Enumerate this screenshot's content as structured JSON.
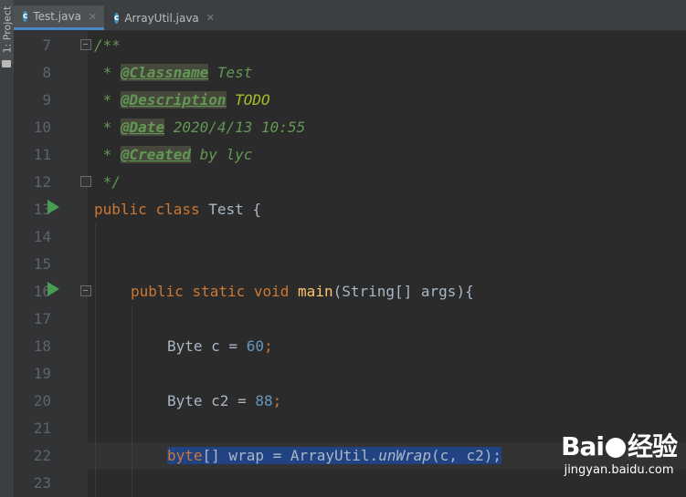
{
  "sidebar": {
    "project_label": "1: Project"
  },
  "tabs": [
    {
      "label": "Test.java",
      "icon": "class-c-icon",
      "active": true
    },
    {
      "label": "ArrayUtil.java",
      "icon": "class-c-icon",
      "active": false
    }
  ],
  "editor": {
    "line_numbers": [
      "7",
      "8",
      "9",
      "10",
      "11",
      "12",
      "13",
      "14",
      "15",
      "16",
      "17",
      "18",
      "19",
      "20",
      "21",
      "22",
      "23"
    ],
    "comment": {
      "open": "/**",
      "star": " * ",
      "classname_tag": "@Classname",
      "classname_value": " Test",
      "description_tag": "@Description",
      "description_value": " TODO",
      "date_tag": "@Date",
      "date_value": " 2020/4/13 10:55",
      "created_tag": "@Created",
      "created_value": " by lyc",
      "close": " */"
    },
    "class_decl": {
      "kw1": "public",
      "kw2": "class",
      "name": " Test {"
    },
    "main_decl": {
      "kw1": "public",
      "kw2": "static",
      "kw3": "void",
      "name": "main",
      "params": "(String[] args){"
    },
    "line18": {
      "text": "Byte c = ",
      "num": "60",
      "end": ";"
    },
    "line20": {
      "text": "Byte c2 = ",
      "num": "88",
      "end": ";"
    },
    "line22": {
      "kw": "byte",
      "text1": "[] wrap = ArrayUtil.",
      "method": "unWrap",
      "text2": "(c, c2);"
    }
  },
  "watermark": {
    "brand_left": "Bai",
    "brand_right": "经验",
    "url": "jingyan.baidu.com"
  },
  "colors": {
    "background": "#2b2b2b",
    "keyword": "#cc7832",
    "comment": "#629755",
    "number": "#6897bb",
    "selection": "#214283",
    "run_icon": "#499c54"
  }
}
